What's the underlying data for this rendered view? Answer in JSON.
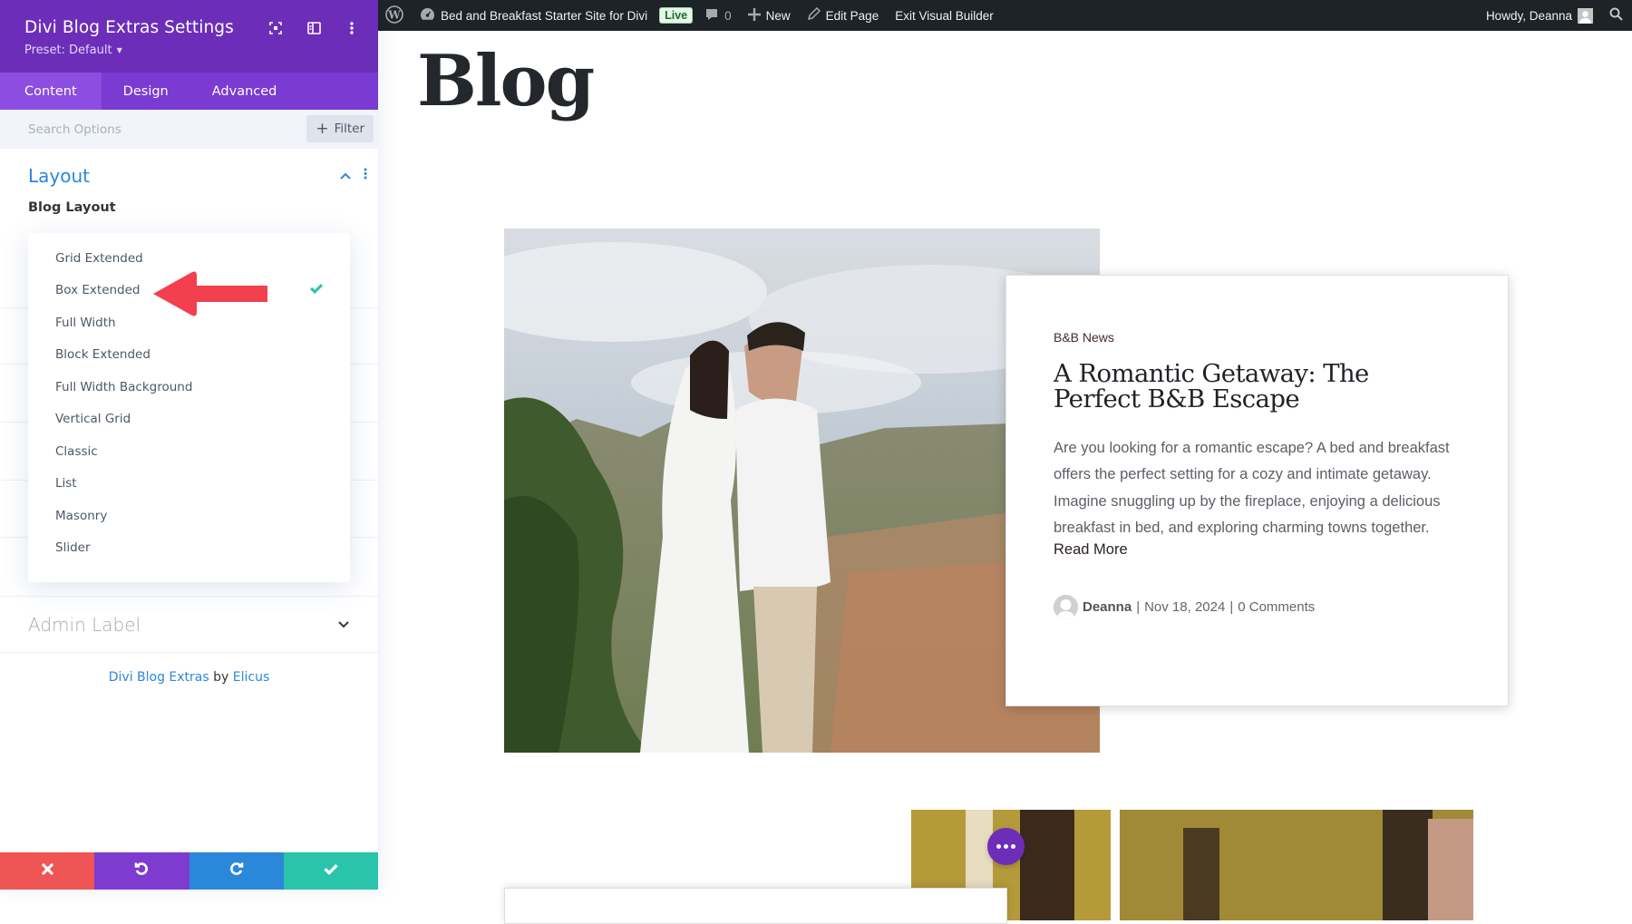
{
  "panel": {
    "title": "Divi Blog Extras Settings",
    "preset": "Preset: Default",
    "tabs": [
      {
        "label": "Content",
        "active": true
      },
      {
        "label": "Design",
        "active": false
      },
      {
        "label": "Advanced",
        "active": false
      }
    ],
    "search_placeholder": "Search Options",
    "filter_label": "Filter",
    "section_layout": {
      "title": "Layout",
      "field_label": "Blog Layout",
      "options": [
        {
          "label": "Grid Extended",
          "selected": false
        },
        {
          "label": "Box Extended",
          "selected": true
        },
        {
          "label": "Full Width",
          "selected": false
        },
        {
          "label": "Block Extended",
          "selected": false
        },
        {
          "label": "Full Width Background",
          "selected": false
        },
        {
          "label": "Vertical Grid",
          "selected": false
        },
        {
          "label": "Classic",
          "selected": false
        },
        {
          "label": "List",
          "selected": false
        },
        {
          "label": "Masonry",
          "selected": false
        },
        {
          "label": "Slider",
          "selected": false
        }
      ]
    },
    "section_admin_label": {
      "title": "Admin Label"
    },
    "credit": {
      "plugin": "Divi Blog Extras",
      "by": "by",
      "author": "Elicus"
    },
    "colors": {
      "header": "#6c2eb9",
      "tabs": "#7b3ad1",
      "accent": "#2b87da",
      "cancel": "#ef5555",
      "undo": "#7e3bd0",
      "redo": "#2b87da",
      "save": "#29c4a9",
      "annotation_arrow": "#f2404f"
    }
  },
  "adminbar": {
    "site_name": "Bed and Breakfast Starter Site for Divi",
    "live_badge": "Live",
    "comments_count": "0",
    "new_label": "New",
    "edit_label": "Edit Page",
    "exit_label": "Exit Visual Builder",
    "greeting": "Howdy, Deanna"
  },
  "page": {
    "heading": "Blog",
    "post": {
      "category": "B&B News",
      "title": "A Romantic Getaway: The Perfect B&B Escape",
      "excerpt": "Are you looking for a romantic escape? A bed and breakfast offers the perfect setting for a cozy and intimate getaway. Imagine snuggling up by the fireplace, enjoying a delicious breakfast in bed, and exploring charming towns together.",
      "read_more": "Read More",
      "author": "Deanna",
      "date": "Nov 18, 2024",
      "comments": "0 Comments",
      "separator": "|"
    }
  }
}
